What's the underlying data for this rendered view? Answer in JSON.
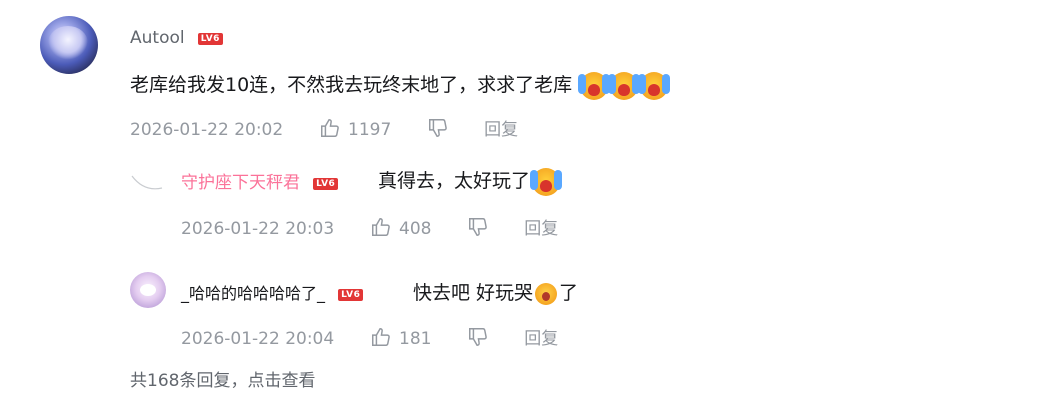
{
  "comment": {
    "username": "Autool",
    "level": "LV6",
    "text": "老库给我发10连，不然我去玩终末地了，求求了老库",
    "emoji": "crying-emoji",
    "time": "2026-01-22 20:02",
    "likes": "1197",
    "reply_label": "回复"
  },
  "replies": [
    {
      "username": "守护座下天秤君",
      "level": "LV6",
      "text": "真得去，太好玩了",
      "emoji": "crying-emoji",
      "time": "2026-01-22 20:03",
      "likes": "408",
      "reply_label": "回复"
    },
    {
      "username": "_哈哈的哈哈哈哈了_",
      "level": "LV6",
      "text_a": "快去吧 好玩哭",
      "text_b": "了",
      "emoji": "sob-emoji",
      "time": "2026-01-22 20:04",
      "likes": "181",
      "reply_label": "回复"
    }
  ],
  "footer": {
    "text": "共168条回复，点击查看"
  },
  "colors": {
    "pink": "#fb7299",
    "gray": "#9499a0",
    "level_red": "#e23636"
  }
}
